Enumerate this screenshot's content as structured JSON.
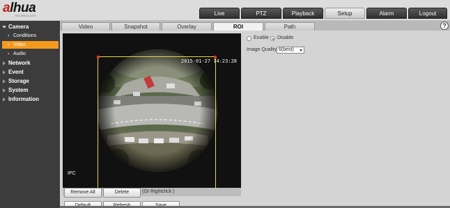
{
  "brand": {
    "name_accent": "a",
    "name_rest": "lhua",
    "tagline": "TECHNOLOGY"
  },
  "main_tabs": [
    {
      "label": "Live",
      "active": false
    },
    {
      "label": "PTZ",
      "active": false
    },
    {
      "label": "Playback",
      "active": false
    },
    {
      "label": "Setup",
      "active": true
    },
    {
      "label": "Alarm",
      "active": false
    },
    {
      "label": "Logout",
      "active": false
    }
  ],
  "sidebar": {
    "camera": {
      "label": "Camera",
      "expanded": true
    },
    "camera_items": [
      {
        "label": "Conditions",
        "active": false
      },
      {
        "label": "Video",
        "active": true
      },
      {
        "label": "Audio",
        "active": false
      }
    ],
    "sections": [
      {
        "label": "Network"
      },
      {
        "label": "Event"
      },
      {
        "label": "Storage"
      },
      {
        "label": "System"
      },
      {
        "label": "Information"
      }
    ]
  },
  "sub_tabs": [
    {
      "label": "Video",
      "active": false
    },
    {
      "label": "Snapshot",
      "active": false
    },
    {
      "label": "Overlay",
      "active": false
    },
    {
      "label": "ROI",
      "active": true
    },
    {
      "label": "Path",
      "active": false
    }
  ],
  "help_icon": "?",
  "video": {
    "timestamp": "2015-01-27 14:23:28",
    "channel_name": "IPC"
  },
  "roi_actions": {
    "remove_all": "Remove All",
    "delete": "Delete",
    "hint": "(Or Rightclick )"
  },
  "roi_settings": {
    "enable_label": "Enable",
    "disable_label": "Disable",
    "selected": "disable",
    "image_quality_label": "Image Quality",
    "image_quality_value": "6(best)"
  },
  "footer_buttons": {
    "default": "Default",
    "refresh": "Refresh",
    "save": "Save"
  },
  "colors": {
    "accent": "#f39a1e",
    "roi_border": "#e6d84a",
    "roi_handle": "#d83a28",
    "sidebar_bg": "#3c3c3c"
  }
}
